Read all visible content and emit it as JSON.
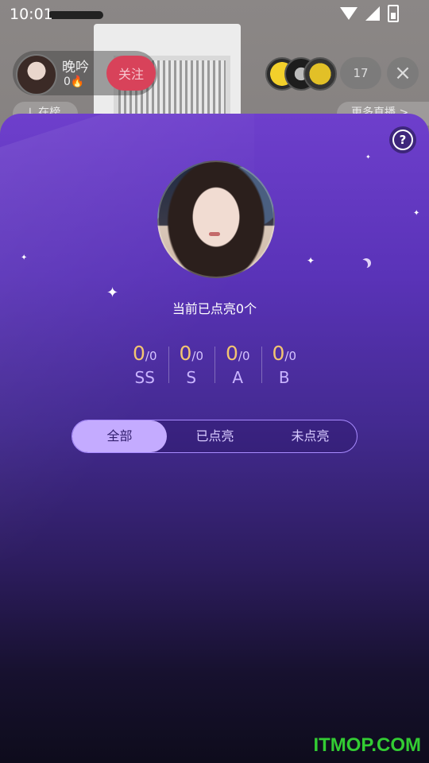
{
  "status_bar": {
    "time": "10:01",
    "icons": [
      "wifi-icon",
      "signal-icon",
      "battery-icon"
    ]
  },
  "host": {
    "name": "晚吟",
    "heat": "0🔥",
    "follow_label": "关注"
  },
  "viewers": {
    "count": "17",
    "close_icon": "×"
  },
  "chips": {
    "rank_label": "↓ 在榜",
    "more_live_label": "更多直播 >"
  },
  "sheet": {
    "help_icon": "?",
    "lit_count_text": "当前已点亮0个",
    "grades": [
      {
        "value": "0",
        "total": "/0",
        "name": "SS"
      },
      {
        "value": "0",
        "total": "/0",
        "name": "S"
      },
      {
        "value": "0",
        "total": "/0",
        "name": "A"
      },
      {
        "value": "0",
        "total": "/0",
        "name": "B"
      }
    ],
    "tabs": [
      {
        "label": "全部",
        "active": true
      },
      {
        "label": "已点亮",
        "active": false
      },
      {
        "label": "未点亮",
        "active": false
      }
    ]
  },
  "colors": {
    "sheet_top": "#6e3fcc",
    "sheet_bottom": "#0e0c1c",
    "grade_number": "#f3c571",
    "active_tab": "#c4abff",
    "follow_button": "#d8425a"
  },
  "watermark": "ITMOP.COM"
}
